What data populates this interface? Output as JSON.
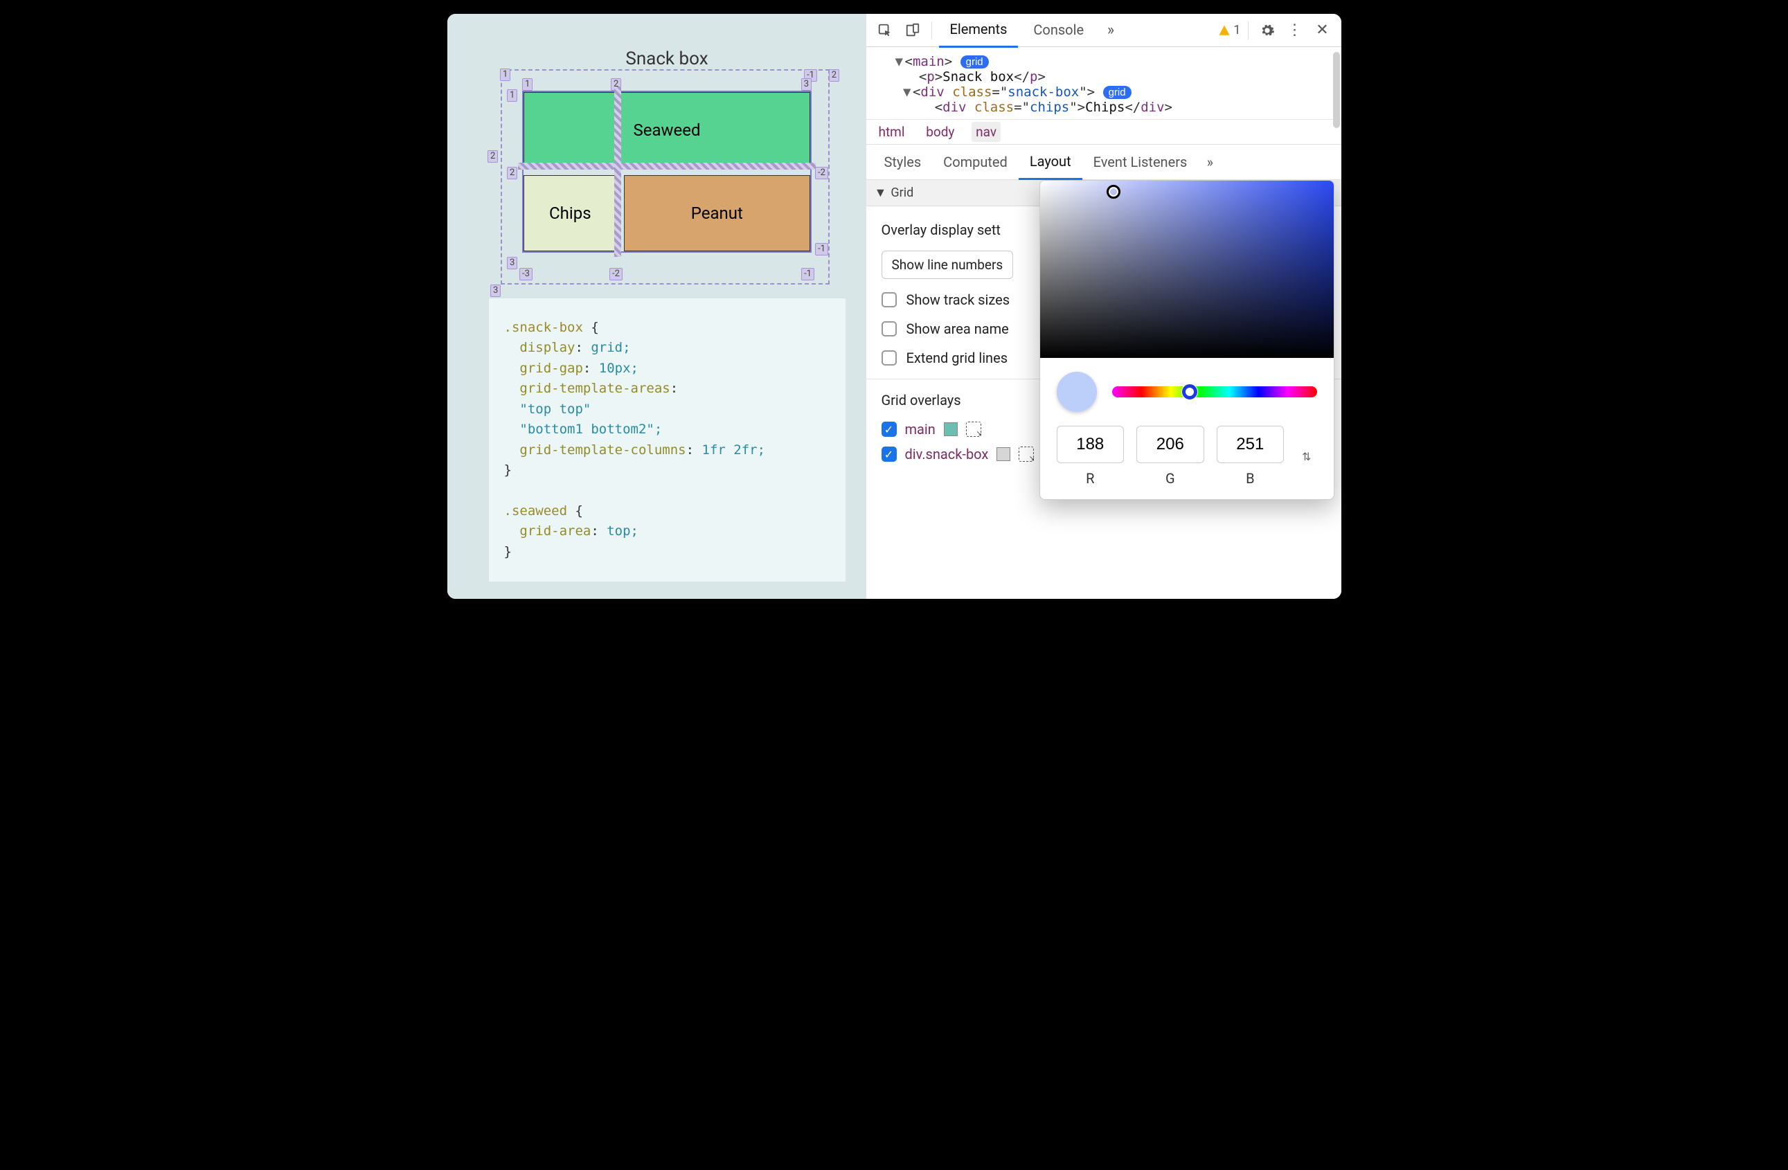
{
  "left": {
    "title": "Snack box",
    "cells": {
      "seaweed": "Seaweed",
      "chips": "Chips",
      "peanut": "Peanut"
    },
    "lineNumbers": {
      "outerTL": "1",
      "outerTRn1": "-1",
      "outerTR2": "2",
      "outerLeft2": "2",
      "outerBottom3": "3",
      "gridTop": [
        "1",
        "2",
        "3"
      ],
      "gridLeft": [
        "1",
        "2"
      ],
      "gridRightNeg": [
        "-2",
        "-1"
      ],
      "gridBottom": [
        "3",
        "-3",
        "-2",
        "-1"
      ]
    },
    "code": ".snack-box {\n  display: grid;\n  grid-gap: 10px;\n  grid-template-areas:\n  \"top top\"\n  \"bottom1 bottom2\";\n  grid-template-columns: 1fr 2fr;\n}\n\n.seaweed {\n  grid-area: top;\n}"
  },
  "toolbar": {
    "tabs": [
      "Elements",
      "Console"
    ],
    "warningCount": "1"
  },
  "dom": {
    "l1_tag": "main",
    "l1_badge": "grid",
    "l2_tag": "p",
    "l2_text": "Snack box",
    "l3_tag": "div",
    "l3_class": "snack-box",
    "l3_badge": "grid",
    "l4_tag": "div",
    "l4_class": "chips",
    "l4_text": "Chips"
  },
  "breadcrumbs": [
    "html",
    "body",
    "nav"
  ],
  "subtabs": [
    "Styles",
    "Computed",
    "Layout",
    "Event Listeners"
  ],
  "layout": {
    "sectionTitle": "Grid",
    "overlayHeader": "Overlay display sett",
    "selectLabel": "Show line numbers",
    "checks": {
      "trackSizes": "Show track sizes",
      "areaNames": "Show area name",
      "extend": "Extend grid lines"
    },
    "overlaysHeader": "Grid overlays",
    "overlays": [
      {
        "name": "main",
        "swatch": "#6bbfb1"
      },
      {
        "name": "div.snack-box",
        "swatch": "#d6d6d6"
      }
    ]
  },
  "picker": {
    "swatch": "#bccffb",
    "r": "188",
    "g": "206",
    "b": "251",
    "labels": {
      "r": "R",
      "g": "G",
      "b": "B"
    }
  }
}
